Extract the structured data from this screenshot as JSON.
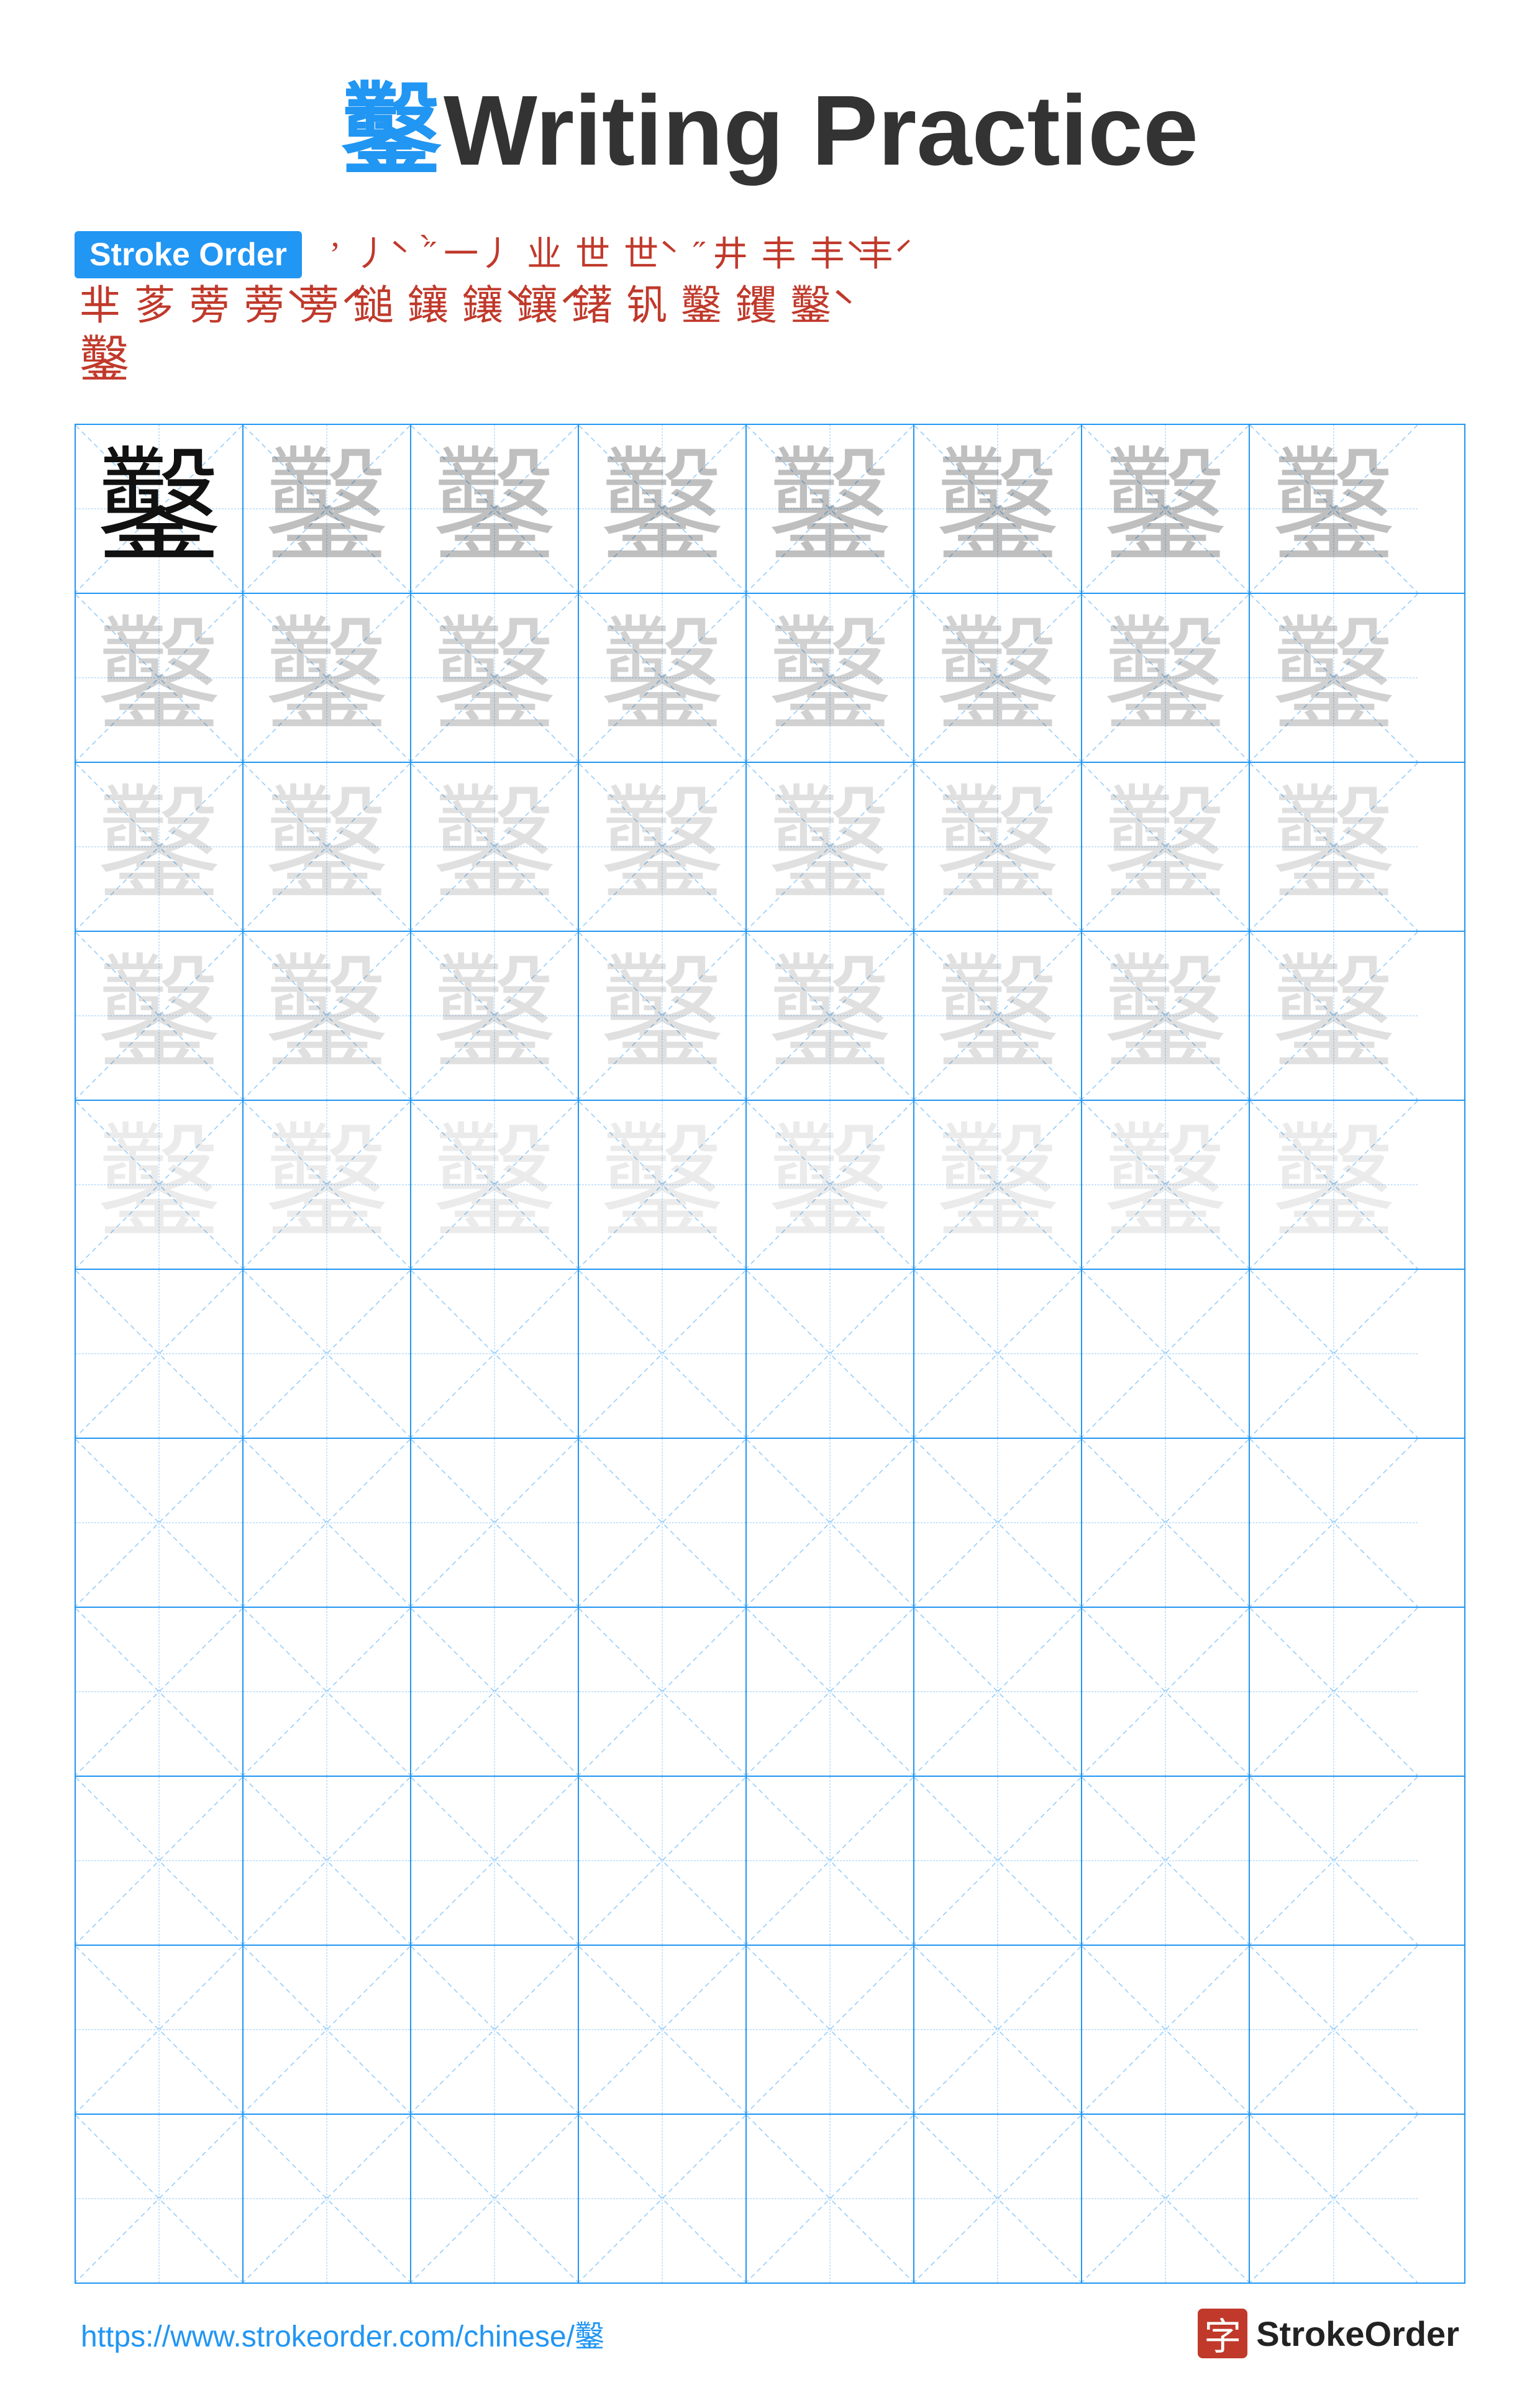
{
  "page": {
    "title_char": "鑿",
    "title_text": "Writing Practice",
    "stroke_order_label": "Stroke Order",
    "stroke_chars_row1": [
      "'",
      "\"",
      "ψ",
      "ψ'",
      "业",
      "业-",
      "业+",
      "业≡",
      "井",
      "丰",
      "丰'",
      "丰\""
    ],
    "stroke_chars_row2": [
      "芈",
      "茤",
      "茤-",
      "蒡",
      "蒡-",
      "蒡+",
      "鐚",
      "鐚-",
      "鐚+",
      "鐚≡",
      "鑿-",
      "鑿+",
      "鑿≡",
      "鑿"
    ],
    "stroke_chars_row3": [
      "鑿"
    ],
    "practice_char": "鑿",
    "footer_url": "https://www.strokeorder.com/chinese/鑿",
    "footer_logo_char": "字",
    "footer_logo_text": "StrokeOrder",
    "grid_cols": 8,
    "grid_rows_with_chars": 5,
    "grid_rows_empty": 6
  }
}
